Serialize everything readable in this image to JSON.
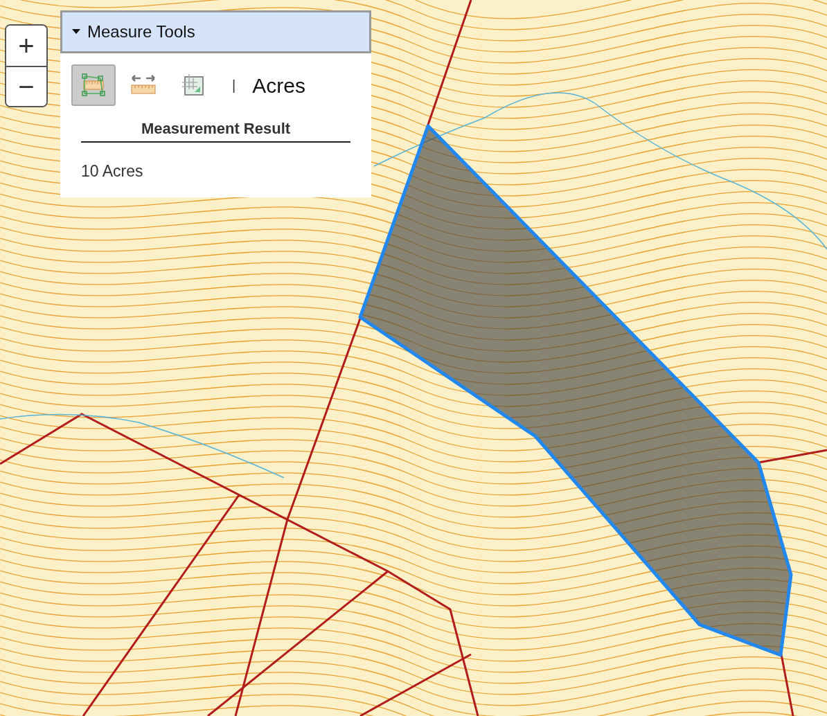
{
  "zoom_controls": {
    "zoom_in": "+",
    "zoom_out": "−"
  },
  "measure_panel": {
    "title": "Measure Tools",
    "expanded": true,
    "tools": [
      {
        "kind": "area",
        "selected": true
      },
      {
        "kind": "distance",
        "selected": false
      },
      {
        "kind": "location",
        "selected": false
      }
    ],
    "separator": "|",
    "unit": "Acres",
    "result_heading": "Measurement Result",
    "result": "10 Acres"
  }
}
